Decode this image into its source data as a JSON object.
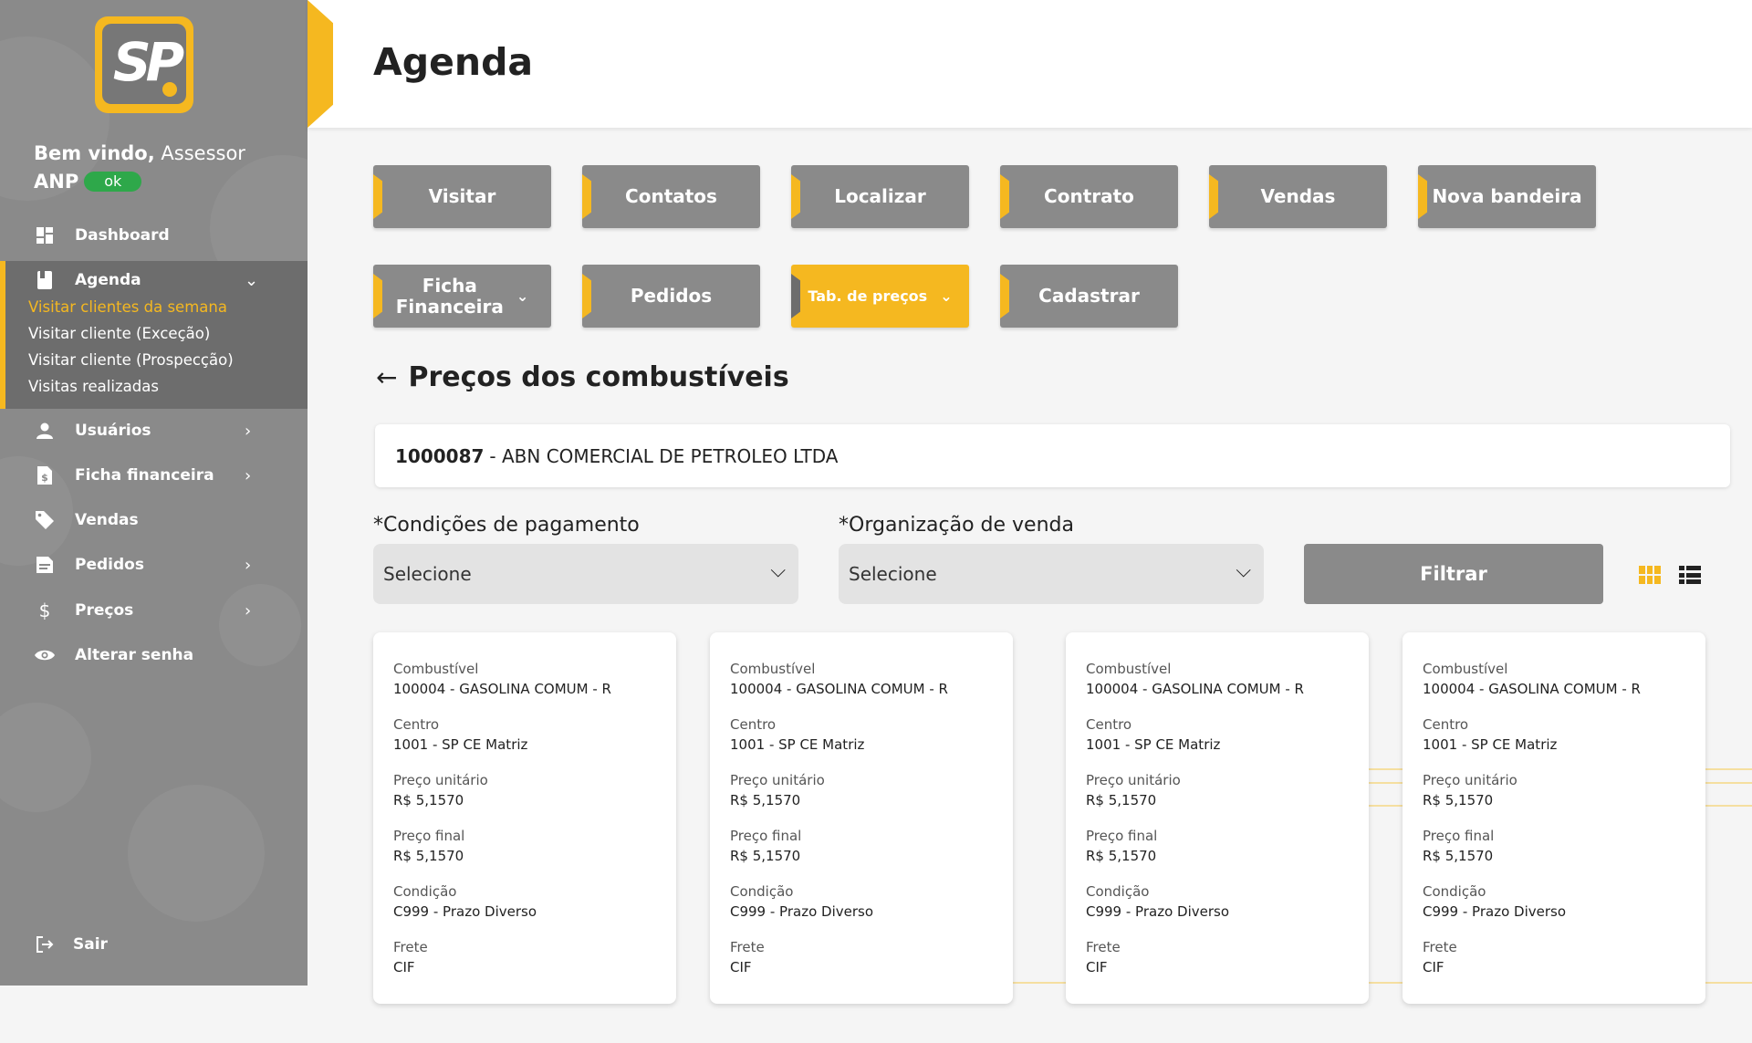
{
  "sidebar": {
    "logo_text": "SP",
    "welcome_prefix": "Bem vindo,",
    "welcome_role": "Assessor",
    "user_name": "ANP",
    "status_badge": "ok",
    "menu": {
      "dashboard": "Dashboard",
      "agenda": "Agenda",
      "agenda_sub": [
        "Visitar clientes da semana",
        "Visitar cliente (Exceção)",
        "Visitar cliente  (Prospecção)",
        "Visitas realizadas"
      ],
      "usuarios": "Usuários",
      "ficha_financeira": "Ficha financeira",
      "vendas": "Vendas",
      "pedidos": "Pedidos",
      "precos": "Preços",
      "alterar_senha": "Alterar senha",
      "sair": "Sair"
    }
  },
  "header": {
    "title": "Agenda"
  },
  "actions": {
    "visitar": "Visitar",
    "contatos": "Contatos",
    "localizar": "Localizar",
    "contrato": "Contrato",
    "vendas": "Vendas",
    "nova_bandeira": "Nova bandeira",
    "ficha_financeira_line1": "Ficha",
    "ficha_financeira_line2": "Financeira",
    "pedidos": "Pedidos",
    "tab_precos": "Tab. de preços",
    "cadastrar": "Cadastrar"
  },
  "section": {
    "title": "Preços dos combustíveis"
  },
  "company": {
    "code": "1000087",
    "name": "- ABN COMERCIAL DE PETROLEO LTDA"
  },
  "filters": {
    "payment_label": "*Condições de pagamento",
    "payment_value": "Selecione",
    "org_label": "*Organização de venda",
    "org_value": "Selecione",
    "filter_button": "Filtrar"
  },
  "card_labels": {
    "combustivel": "Combustível",
    "centro": "Centro",
    "preco_unitario": "Preço unitário",
    "preco_final": "Preço final",
    "condicao": "Condição",
    "frete": "Frete"
  },
  "cards": [
    {
      "combustivel": "100004 - GASOLINA COMUM - R",
      "centro": "1001 - SP CE Matriz",
      "preco_unitario": "R$ 5,1570",
      "preco_final": "R$ 5,1570",
      "condicao": "C999 - Prazo Diverso",
      "frete": "CIF"
    },
    {
      "combustivel": "100004 - GASOLINA COMUM - R",
      "centro": "1001 - SP CE Matriz",
      "preco_unitario": "R$ 5,1570",
      "preco_final": "R$ 5,1570",
      "condicao": "C999 - Prazo Diverso",
      "frete": "CIF"
    },
    {
      "combustivel": "100004 - GASOLINA COMUM - R",
      "centro": "1001 - SP CE Matriz",
      "preco_unitario": "R$ 5,1570",
      "preco_final": "R$ 5,1570",
      "condicao": "C999 - Prazo Diverso",
      "frete": "CIF"
    },
    {
      "combustivel": "100004 - GASOLINA COMUM - R",
      "centro": "1001 - SP CE Matriz",
      "preco_unitario": "R$ 5,1570",
      "preco_final": "R$ 5,1570",
      "condicao": "C999 - Prazo Diverso",
      "frete": "CIF"
    }
  ],
  "colors": {
    "accent": "#f5b820",
    "sidebar": "#8a8a8a",
    "sidebar_active": "#6d6d6d",
    "ok_badge": "#2ea84a"
  },
  "icons": [
    "dashboard-icon",
    "agenda-icon",
    "user-icon",
    "finance-doc-icon",
    "tag-icon",
    "order-doc-icon",
    "dollar-icon",
    "eye-icon",
    "logout-icon",
    "back-arrow-icon",
    "grid-view-icon",
    "list-view-icon"
  ]
}
